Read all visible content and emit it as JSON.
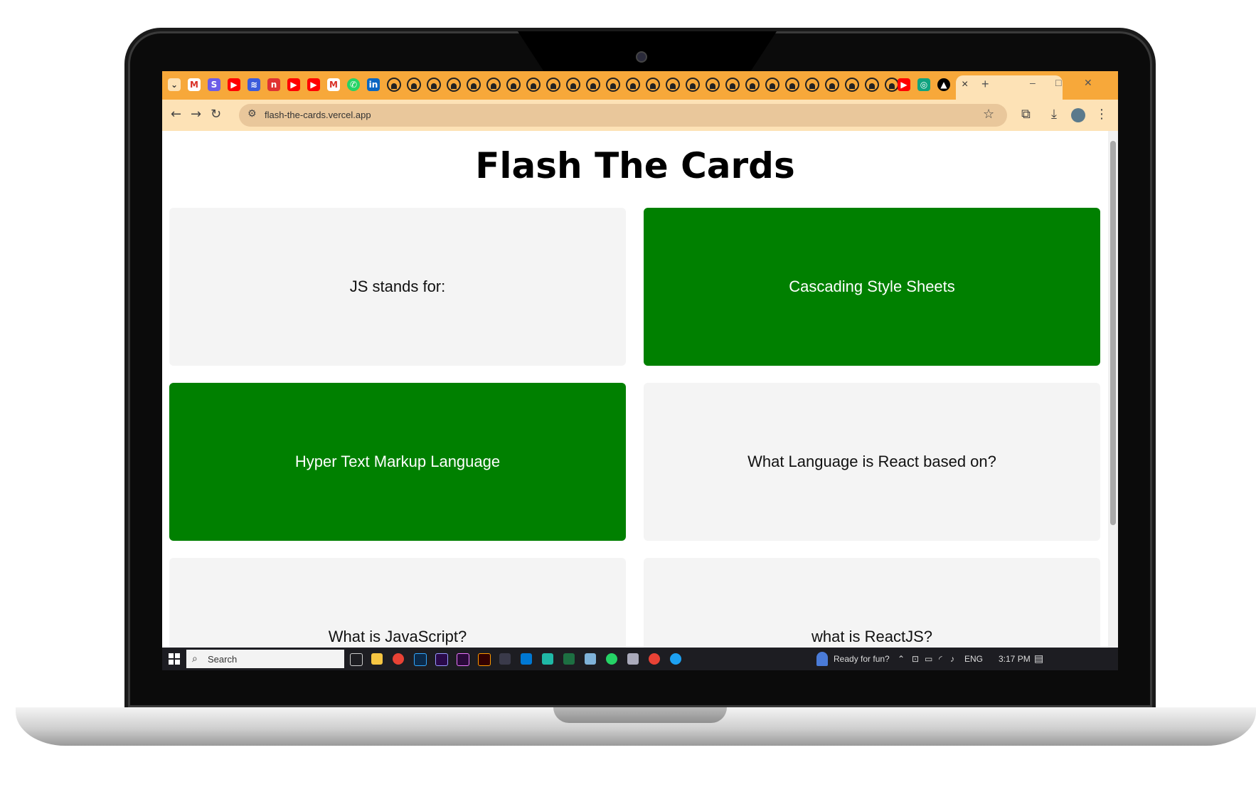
{
  "browser": {
    "url": "flash-the-cards.vercel.app",
    "tab_close": "×",
    "new_tab": "+",
    "win_min": "–",
    "win_max": "□",
    "win_close": "✕"
  },
  "page": {
    "title": "Flash The Cards",
    "cards": [
      {
        "text": "JS stands for:",
        "state": "question"
      },
      {
        "text": "Cascading Style Sheets",
        "state": "answer"
      },
      {
        "text": "Hyper Text Markup Language",
        "state": "answer"
      },
      {
        "text": "What Language is React based on?",
        "state": "question"
      },
      {
        "text": "What is JavaScript?",
        "state": "question"
      },
      {
        "text": "what is ReactJS?",
        "state": "question"
      }
    ],
    "colors": {
      "answer": "#008000",
      "question": "#f4f4f4",
      "tabstrip": "#f7a83a"
    }
  },
  "taskbar": {
    "search_placeholder": "Search",
    "weather": "Ready for fun?",
    "language": "ENG",
    "time": "3:17 PM"
  }
}
